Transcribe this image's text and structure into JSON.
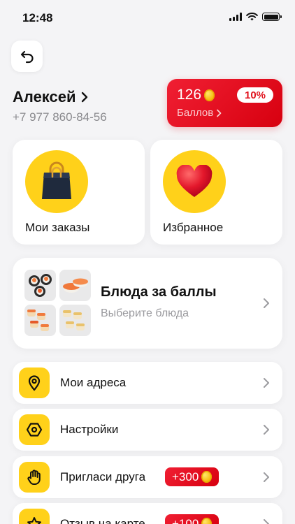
{
  "status_bar": {
    "time": "12:48"
  },
  "profile": {
    "name": "Алексей",
    "phone": "+7 977 860-84-56"
  },
  "bonus": {
    "points": "126",
    "percent": "10%",
    "label": "Баллов"
  },
  "tiles": [
    {
      "label": "Мои заказы",
      "icon": "shopping-bag-icon"
    },
    {
      "label": "Избранное",
      "icon": "heart-icon"
    }
  ],
  "dishes": {
    "title": "Блюда за баллы",
    "subtitle": "Выберите блюда"
  },
  "menu": [
    {
      "label": "Мои адреса",
      "icon": "location-pin-icon"
    },
    {
      "label": "Настройки",
      "icon": "settings-hexagon-icon"
    },
    {
      "label": "Пригласи друга",
      "icon": "hand-icon",
      "badge": "+300"
    },
    {
      "label": "Отзыв на карте",
      "icon": "star-icon",
      "badge": "+100"
    }
  ],
  "colors": {
    "accent_yellow": "#ffd11a",
    "accent_red": "#e1141e",
    "background": "#f4f4f6"
  }
}
